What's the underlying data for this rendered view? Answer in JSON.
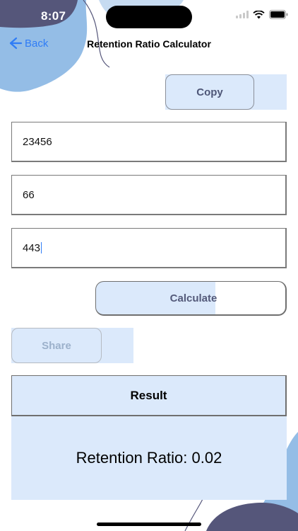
{
  "status_bar": {
    "time": "8:07"
  },
  "nav": {
    "back_label": "Back",
    "title": "Retention Ratio Calculator"
  },
  "actions": {
    "copy_label": "Copy",
    "calculate_label": "Calculate",
    "share_label": "Share"
  },
  "inputs": [
    {
      "value": "23456"
    },
    {
      "value": "66"
    },
    {
      "value": "443"
    }
  ],
  "result": {
    "header": "Result",
    "text": "Retention Ratio: 0.02"
  },
  "colors": {
    "accent_blue": "#2f7cf6",
    "panel_blue": "#dbe9fb",
    "blob_light_blue": "#94bde6",
    "blob_dark_navy": "#55567a"
  }
}
